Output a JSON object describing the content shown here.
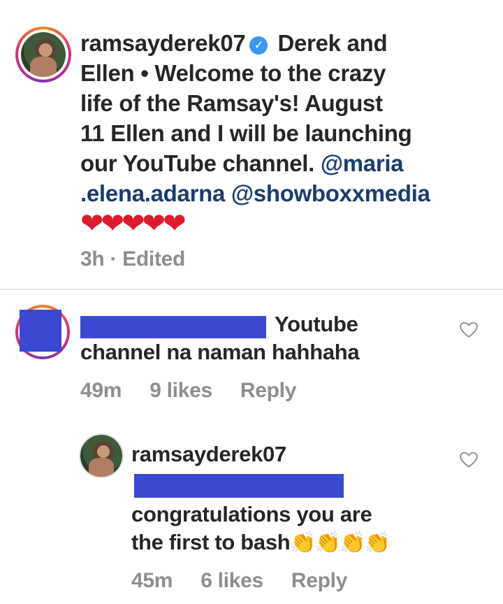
{
  "post": {
    "username": "ramsayderek07",
    "verified_icon": "verified-badge-icon",
    "caption_lines": [
      "Derek and",
      "Ellen • Welcome to the crazy",
      "life of the Ramsay's! August",
      "11 Ellen and I will be launching",
      "our YouTube channel. "
    ],
    "mention_1a": "@maria",
    "mention_1b": ".elena.adarna",
    "mention_2": "@showboxxmedia",
    "hearts": "❤❤❤❤❤",
    "meta": "3h · Edited"
  },
  "comment1": {
    "text_line1": "Youtube",
    "text_line2": "channel na naman hahhaha",
    "time": "49m",
    "likes": "9 likes",
    "reply": "Reply"
  },
  "reply1": {
    "username": "ramsayderek07",
    "text_line1": "congratulations you are",
    "text_line2": "the first to bash",
    "claps": "👏👏👏👏",
    "time": "45m",
    "likes": "6 likes",
    "reply": "Reply"
  },
  "colors": {
    "link": "#1a3d6e",
    "muted": "#8e8e8e",
    "verified": "#3897f0",
    "redaction": "#3b48d1"
  }
}
